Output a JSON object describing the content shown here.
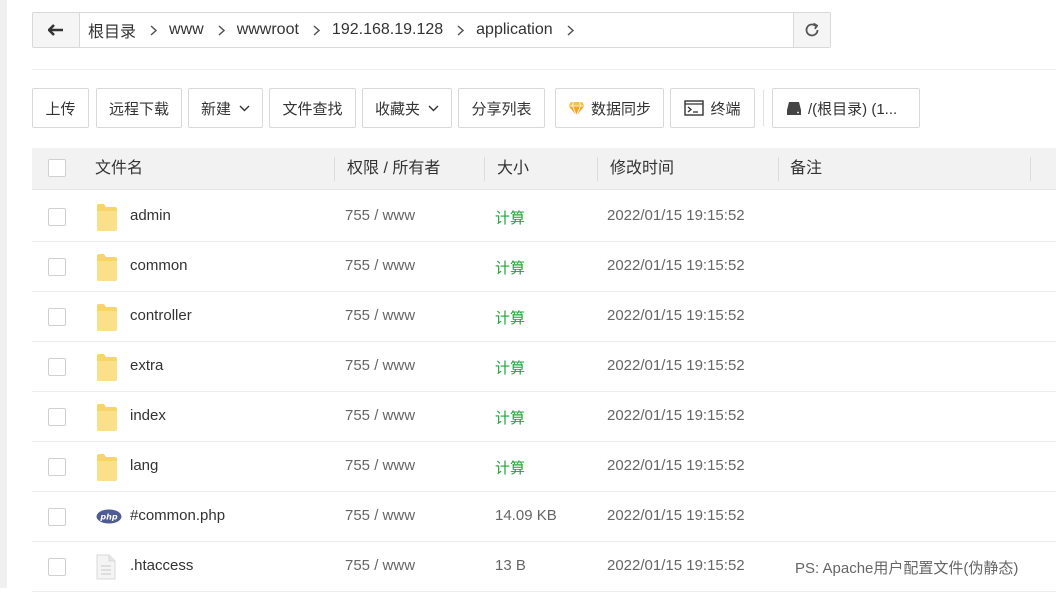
{
  "breadcrumb": {
    "items": [
      "根目录",
      "www",
      "wwwroot",
      "192.168.19.128",
      "application"
    ]
  },
  "toolbar": {
    "upload": "上传",
    "remote_download": "远程下载",
    "new": "新建",
    "file_search": "文件查找",
    "favorites": "收藏夹",
    "share_list": "分享列表",
    "data_sync": "数据同步",
    "terminal": "终端",
    "disk": "/(根目录) (1..."
  },
  "table": {
    "headers": {
      "name": "文件名",
      "perm": "权限 / 所有者",
      "size": "大小",
      "mtime": "修改时间",
      "note": "备注"
    },
    "rows": [
      {
        "name": "admin",
        "type": "folder",
        "perm": "755 / www",
        "size": "计算",
        "mtime": "2022/01/15 19:15:52",
        "note": ""
      },
      {
        "name": "common",
        "type": "folder",
        "perm": "755 / www",
        "size": "计算",
        "mtime": "2022/01/15 19:15:52",
        "note": ""
      },
      {
        "name": "controller",
        "type": "folder",
        "perm": "755 / www",
        "size": "计算",
        "mtime": "2022/01/15 19:15:52",
        "note": ""
      },
      {
        "name": "extra",
        "type": "folder",
        "perm": "755 / www",
        "size": "计算",
        "mtime": "2022/01/15 19:15:52",
        "note": ""
      },
      {
        "name": "index",
        "type": "folder",
        "perm": "755 / www",
        "size": "计算",
        "mtime": "2022/01/15 19:15:52",
        "note": ""
      },
      {
        "name": "lang",
        "type": "folder",
        "perm": "755 / www",
        "size": "计算",
        "mtime": "2022/01/15 19:15:52",
        "note": ""
      },
      {
        "name": "#common.php",
        "type": "php",
        "perm": "755 / www",
        "size": "14.09 KB",
        "mtime": "2022/01/15 19:15:52",
        "note": ""
      },
      {
        "name": ".htaccess",
        "type": "file",
        "perm": "755 / www",
        "size": "13 B",
        "mtime": "2022/01/15 19:15:52",
        "note": "PS: Apache用户配置文件(伪静态)"
      }
    ]
  },
  "icons": {
    "php_badge": "php"
  },
  "colors": {
    "calc_green": "#20a53a",
    "folder_yellow": "#f8d56b",
    "header_bg": "#f2f2f2"
  }
}
